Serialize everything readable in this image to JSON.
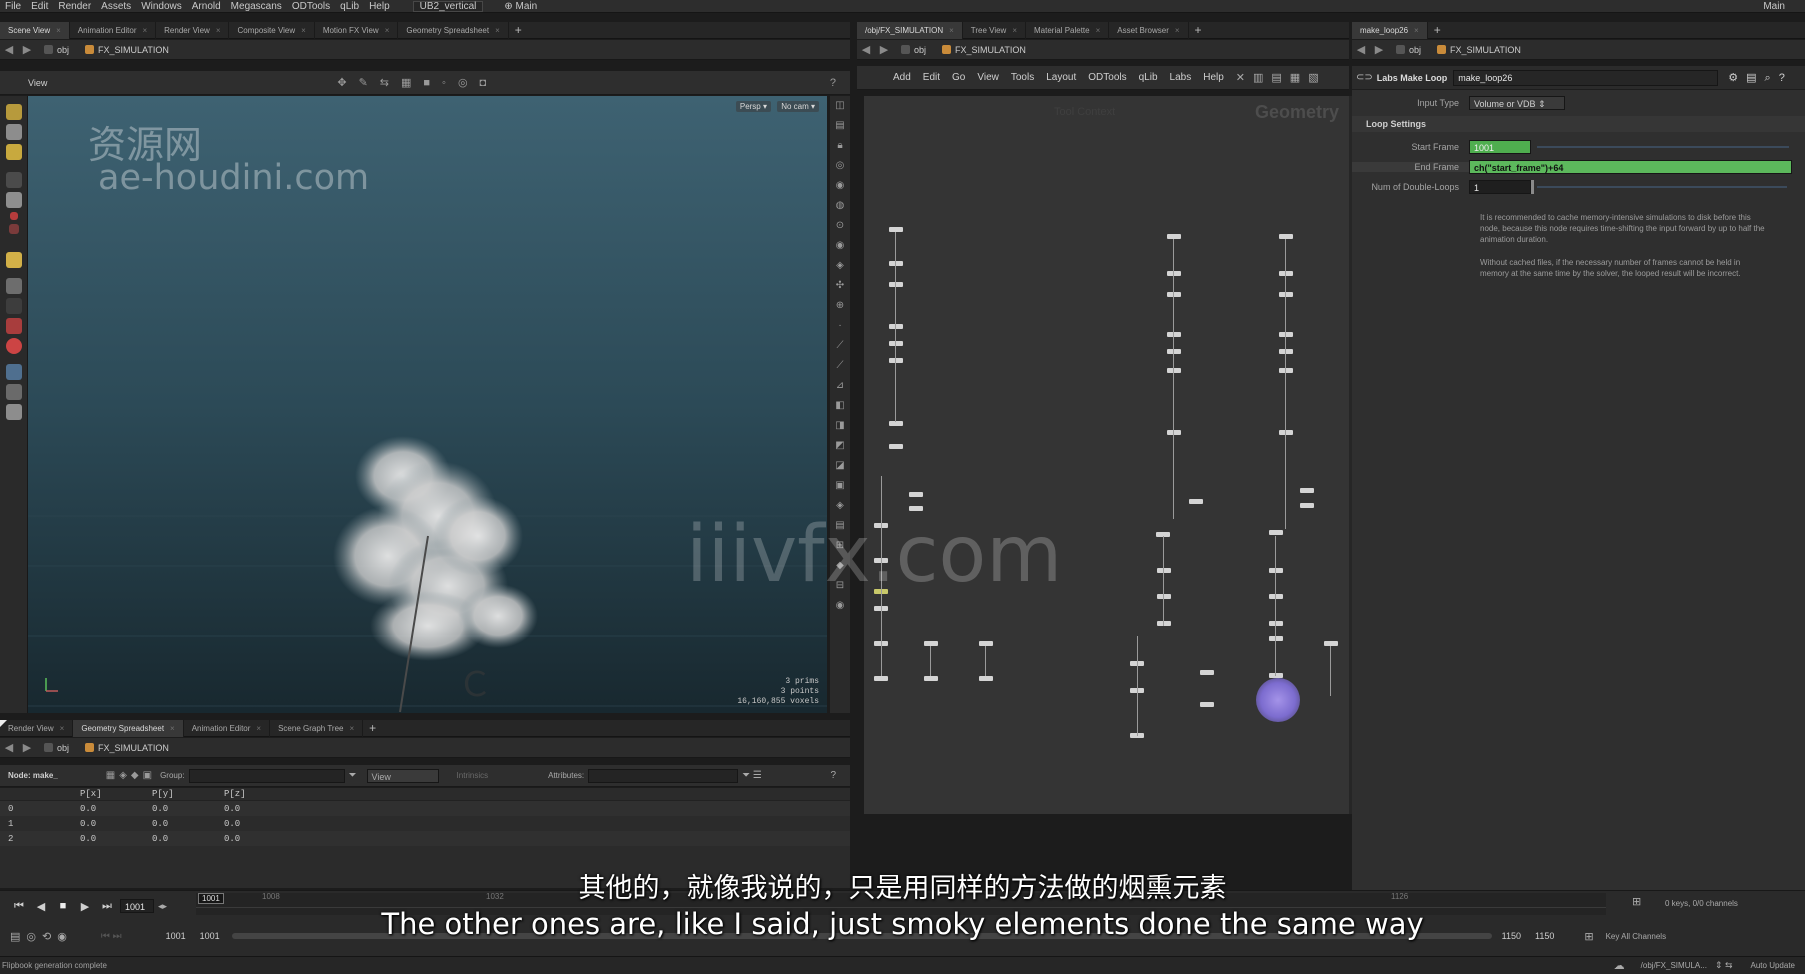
{
  "menubar": {
    "items": [
      "File",
      "Edit",
      "Render",
      "Assets",
      "Windows",
      "Arnold",
      "Megascans",
      "ODTools",
      "qLib",
      "Help"
    ],
    "desktop": "UB2_vertical",
    "desk_right": "Main",
    "main_right": "Main"
  },
  "left_pane": {
    "tabs": [
      "Scene View",
      "Animation Editor",
      "Render View",
      "Composite View",
      "Motion FX View",
      "Geometry Spreadsheet"
    ],
    "path": [
      "obj",
      "FX_SIMULATION"
    ],
    "view_label": "View",
    "persp": "Persp ▾",
    "cam": "No cam ▾",
    "stats": [
      "3  prims",
      "3  points",
      "16,160,855  voxels"
    ],
    "watermark_cn": "资源网",
    "watermark_url": "ae-houdini.com"
  },
  "mid_pane": {
    "tabs": [
      "/obj/FX_SIMULATION",
      "Tree View",
      "Material Palette",
      "Asset Browser"
    ],
    "path": [
      "obj",
      "FX_SIMULATION"
    ],
    "menu": [
      "Add",
      "Edit",
      "Go",
      "View",
      "Tools",
      "Layout",
      "ODTools",
      "qLib",
      "Labs",
      "Help"
    ],
    "context_label": "Geometry",
    "faded_label": "Tool Context"
  },
  "right_pane": {
    "tabs": [
      "make_loop26"
    ],
    "path": [
      "obj",
      "FX_SIMULATION"
    ],
    "node_type": "Labs Make Loop",
    "node_name": "make_loop26",
    "input_type_label": "Input Type",
    "input_type_value": "Volume or VDB",
    "section": "Loop Settings",
    "start_label": "Start Frame",
    "start_value": "1001",
    "end_label": "End Frame",
    "end_value": "ch(\"start_frame\")+64",
    "double_label": "Num of Double-Loops",
    "double_value": "1",
    "help1": "It is recommended to cache memory-intensive simulations to disk before this node, because this node requires time-shifting the input forward by up to half the animation duration.",
    "help2": "Without cached files, if the necessary number of frames cannot be held in memory at the same time by the solver, the looped result will be incorrect."
  },
  "sheet": {
    "tabs": [
      "Render View",
      "Geometry Spreadsheet",
      "Animation Editor",
      "Scene Graph Tree"
    ],
    "path": [
      "obj",
      "FX_SIMULATION"
    ],
    "node_label": "Node: make_",
    "group_label": "Group:",
    "view_label": "View",
    "intrinsics_label": "Intrinsics",
    "attributes_label": "Attributes:",
    "columns": [
      "P[x]",
      "P[y]",
      "P[z]"
    ],
    "rows": [
      [
        "0",
        "0.0",
        "0.0",
        "0.0"
      ],
      [
        "1",
        "0.0",
        "0.0",
        "0.0"
      ],
      [
        "2",
        "0.0",
        "0.0",
        "0.0"
      ]
    ]
  },
  "timeline": {
    "current_frame": "1001",
    "marker": "1001",
    "ticks": [
      "1008",
      "1032",
      "1126"
    ],
    "range_start": "1001",
    "range_start2": "1001",
    "range_end": "1150",
    "range_end2": "1150",
    "keys_info": "0 keys, 0/0 channels",
    "key_all": "Key All Channels"
  },
  "status": {
    "message": "Flipbook generation complete",
    "path": "/obj/FX_SIMULA...",
    "auto_update": "Auto Update"
  },
  "subtitles": {
    "cn": "其他的，就像我说的，只是用同样的方法做的烟熏元素",
    "en": "The other ones are, like I said, just smoky elements done the same way"
  },
  "watermark_center": "iiivfx.com",
  "colors": {
    "accent_green": "#5cb85c",
    "node_purple": "#8a7ad6",
    "viewport_top": "#3e6272"
  }
}
